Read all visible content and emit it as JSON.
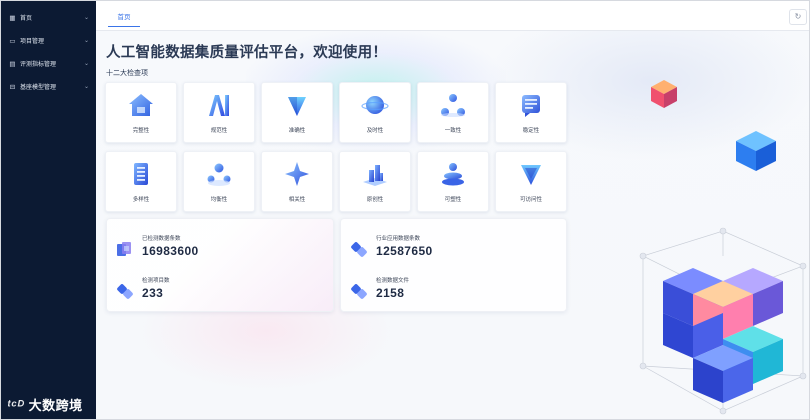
{
  "sidebar": {
    "items": [
      {
        "label": "首页",
        "icon": "grid-icon"
      },
      {
        "label": "项目管理",
        "icon": "folder-icon"
      },
      {
        "label": "评测指标管理",
        "icon": "clipboard-icon"
      },
      {
        "label": "基座模型管理",
        "icon": "database-icon"
      }
    ],
    "logo_text": "大数跨境"
  },
  "tabs": [
    {
      "label": "首页",
      "active": true
    }
  ],
  "header": {
    "welcome": "人工智能数据集质量评估平台，欢迎使用！",
    "section_title": "十二大检查项"
  },
  "checks": [
    {
      "label": "完整性",
      "icon": "house-icon"
    },
    {
      "label": "规范性",
      "icon": "ai-letters-icon"
    },
    {
      "label": "准确性",
      "icon": "gem-icon"
    },
    {
      "label": "及时性",
      "icon": "globe-icon"
    },
    {
      "label": "一致性",
      "icon": "nodes-icon"
    },
    {
      "label": "稳定性",
      "icon": "document-icon"
    },
    {
      "label": "多样性",
      "icon": "list-icon"
    },
    {
      "label": "均衡性",
      "icon": "balance-icon"
    },
    {
      "label": "相关性",
      "icon": "star-icon"
    },
    {
      "label": "原创性",
      "icon": "city-icon"
    },
    {
      "label": "可塑性",
      "icon": "layers-icon"
    },
    {
      "label": "可访问性",
      "icon": "funnel-icon"
    }
  ],
  "stats": {
    "left": [
      {
        "label": "已检测数据条数",
        "value": "16983600",
        "icon": "cube-stack-icon"
      },
      {
        "label": "检测项目数",
        "value": "233",
        "icon": "link-icon"
      }
    ],
    "right": [
      {
        "label": "行业应用数据条数",
        "value": "12587650",
        "icon": "link-icon"
      },
      {
        "label": "检测数据文件",
        "value": "2158",
        "icon": "link-icon"
      }
    ]
  },
  "colors": {
    "sidebar_bg": "#0c1a33",
    "accent": "#3a74e8",
    "title": "#2b3a55"
  }
}
